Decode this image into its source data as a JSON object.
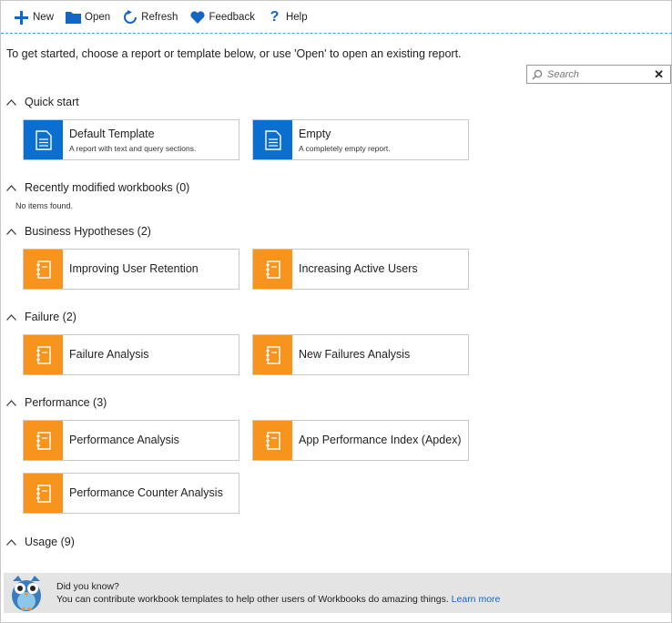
{
  "toolbar": {
    "new_label": "New",
    "open_label": "Open",
    "refresh_label": "Refresh",
    "feedback_label": "Feedback",
    "help_label": "Help"
  },
  "intro": "To get started, choose a report or template below, or use 'Open' to open an existing report.",
  "search": {
    "placeholder": "Search",
    "clear_glyph": "✕"
  },
  "sections": {
    "quick_start": {
      "title": "Quick start",
      "tiles": [
        {
          "name": "Default Template",
          "description": "A report with text and query sections."
        },
        {
          "name": "Empty",
          "description": "A completely empty report."
        }
      ]
    },
    "recent": {
      "title": "Recently modified workbooks (0)",
      "empty_text": "No items found."
    },
    "business": {
      "title": "Business Hypotheses (2)",
      "tiles": [
        {
          "name": "Improving User Retention"
        },
        {
          "name": "Increasing Active Users"
        }
      ]
    },
    "failure": {
      "title": "Failure (2)",
      "tiles": [
        {
          "name": "Failure Analysis"
        },
        {
          "name": "New Failures Analysis"
        }
      ]
    },
    "performance": {
      "title": "Performance (3)",
      "tiles": [
        {
          "name": "Performance Analysis"
        },
        {
          "name": "App Performance Index (Apdex)"
        },
        {
          "name": "Performance Counter Analysis"
        }
      ]
    },
    "usage": {
      "title": "Usage (9)"
    }
  },
  "footer": {
    "heading": "Did you know?",
    "text": "You can contribute workbook templates to help other users of Workbooks do amazing things.",
    "link": "Learn more"
  },
  "colors": {
    "accent": "#1466c4",
    "tile_blue": "#0a6fcf",
    "tile_orange": "#f7941d",
    "footer_bg": "#e4e4e4"
  },
  "icons": {
    "new": "plus-icon",
    "open": "folder-icon",
    "refresh": "refresh-icon",
    "feedback": "heart-icon",
    "help": "question-icon",
    "template": "document-icon",
    "notebook": "notebook-icon",
    "mascot": "owl-icon"
  }
}
